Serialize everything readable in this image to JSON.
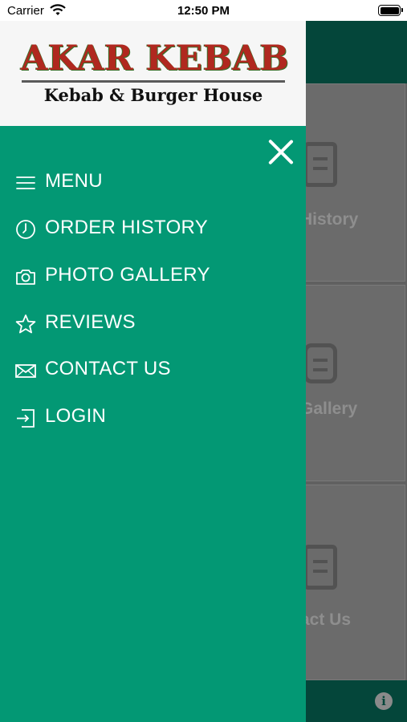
{
  "status_bar": {
    "carrier": "Carrier",
    "time": "12:50 PM"
  },
  "brand": {
    "title": "AKAR KEBAB",
    "subtitle": "Kebab & Burger House"
  },
  "menu": {
    "items": [
      {
        "label": "MENU",
        "icon": "hamburger-icon"
      },
      {
        "label": "ORDER HISTORY",
        "icon": "clock-icon"
      },
      {
        "label": "PHOTO GALLERY",
        "icon": "camera-icon"
      },
      {
        "label": "REVIEWS",
        "icon": "star-icon"
      },
      {
        "label": "CONTACT US",
        "icon": "envelope-icon"
      },
      {
        "label": "LOGIN",
        "icon": "login-icon"
      }
    ]
  },
  "background": {
    "tiles": [
      {
        "label": "History"
      },
      {
        "label": "Gallery"
      },
      {
        "label": "act Us"
      }
    ]
  },
  "colors": {
    "drawer": "#039874",
    "header": "#04463a",
    "accent_red": "#b0281f"
  }
}
